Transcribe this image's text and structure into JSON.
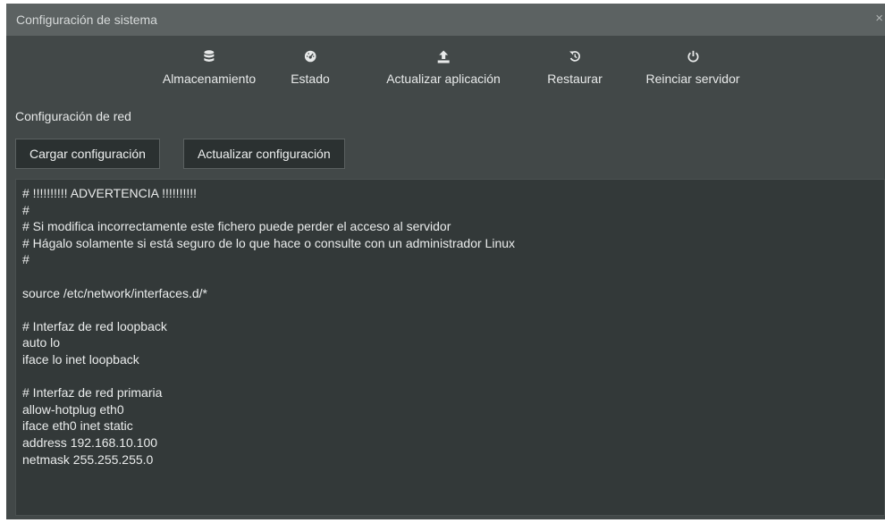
{
  "dialog": {
    "title": "Configuración de sistema",
    "close_icon": "×"
  },
  "toolbar": {
    "items": [
      {
        "label": "Almacenamiento",
        "icon": "database-icon"
      },
      {
        "label": "Estado",
        "icon": "gauge-icon"
      },
      {
        "label": "Actualizar aplicación",
        "icon": "upload-icon"
      },
      {
        "label": "Restaurar",
        "icon": "restore-icon"
      },
      {
        "label": "Reinciar servidor",
        "icon": "power-icon"
      }
    ]
  },
  "network": {
    "section_title": "Configuración de red",
    "load_button": "Cargar configuración",
    "update_button": "Actualizar configuración",
    "config_lines": [
      "# !!!!!!!!!! ADVERTENCIA !!!!!!!!!!",
      "#",
      "# Si modifica incorrectamente este fichero puede perder el acceso al servidor",
      "# Hágalo solamente si está seguro de lo que hace o consulte con un administrador Linux",
      "#",
      "",
      "source /etc/network/interfaces.d/*",
      "",
      "# Interfaz de red loopback",
      "auto lo",
      "iface lo inet loopback",
      "",
      "# Interfaz de red primaria",
      "allow-hotplug eth0",
      "iface eth0 inet static",
      "address 192.168.10.100",
      "netmask 255.255.255.0"
    ]
  },
  "colors": {
    "dialog_bg": "#424848",
    "titlebar_bg": "#5c6262",
    "editor_bg": "#333939",
    "button_bg": "#2b3131"
  }
}
